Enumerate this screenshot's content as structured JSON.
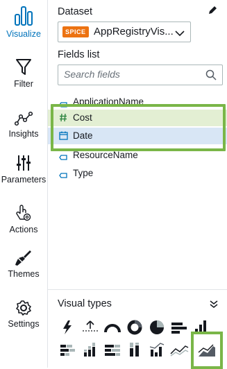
{
  "nav": {
    "items": [
      {
        "label": "Visualize",
        "icon": "visualize-icon",
        "active": true
      },
      {
        "label": "Filter",
        "icon": "filter-icon"
      },
      {
        "label": "Insights",
        "icon": "insights-icon"
      },
      {
        "label": "Parameters",
        "icon": "parameters-icon"
      },
      {
        "label": "Actions",
        "icon": "actions-icon"
      },
      {
        "label": "Themes",
        "icon": "themes-icon"
      },
      {
        "label": "Settings",
        "icon": "settings-icon"
      }
    ]
  },
  "dataset": {
    "label": "Dataset",
    "badge": "SPICE",
    "name": "AppRegistryVis..."
  },
  "fields": {
    "label": "Fields list",
    "search_placeholder": "Search fields",
    "items": [
      {
        "name": "ApplicationName",
        "kind": "dimension"
      },
      {
        "name": "Cost",
        "kind": "measure",
        "selected": true
      },
      {
        "name": "Date",
        "kind": "date",
        "selected": true
      },
      {
        "name": "ResourceName",
        "kind": "dimension"
      },
      {
        "name": "Type",
        "kind": "dimension"
      }
    ]
  },
  "visual_types": {
    "label": "Visual types",
    "icons": [
      "autograph-icon",
      "kpi-icon",
      "gauge-icon",
      "donut-icon",
      "pie-icon",
      "horizontal-bar-icon",
      "vertical-bar-icon",
      "horizontal-stacked-bar-icon",
      "vertical-stacked-bar-icon",
      "horizontal-stacked-100-bar-icon",
      "vertical-stacked-100-bar-icon",
      "combo-chart-icon",
      "line-chart-icon",
      "area-line-chart-icon"
    ],
    "selected": "area-line-chart-icon"
  },
  "colors": {
    "accent": "#0073bb",
    "spice_badge": "#ec7211",
    "highlight_outline": "#7ab648",
    "field_selected_green": "#e3efd3",
    "field_selected_blue": "#d8e6f5"
  }
}
